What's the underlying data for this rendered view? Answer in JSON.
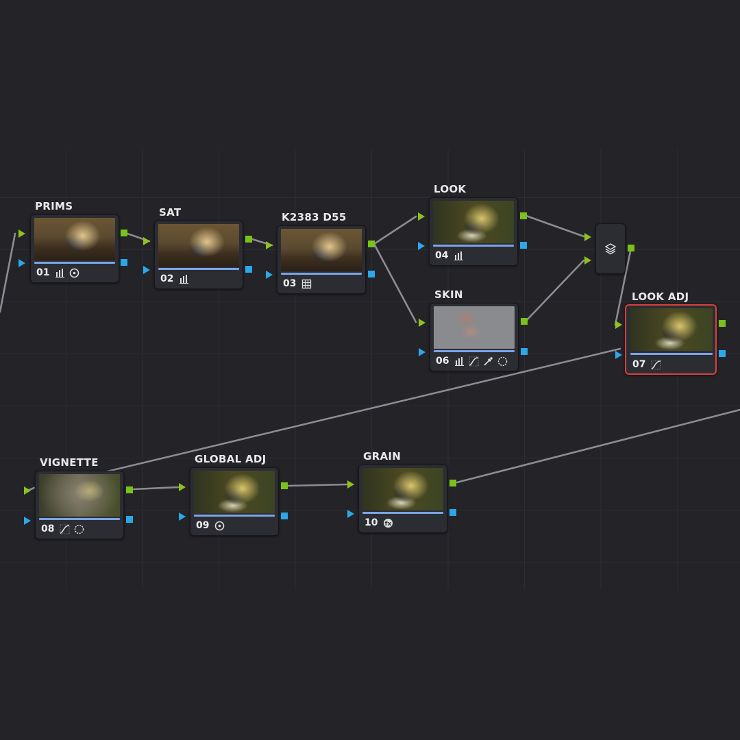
{
  "nodes": [
    {
      "id": "prims",
      "title": "PRIMS",
      "number": "01",
      "tools": [
        "qualifier-bars-icon",
        "window-circle-icon"
      ]
    },
    {
      "id": "sat",
      "title": "SAT",
      "number": "02",
      "tools": [
        "qualifier-bars-icon"
      ]
    },
    {
      "id": "k2383",
      "title": "K2383 D55",
      "number": "03",
      "tools": [
        "lut-grid-icon"
      ]
    },
    {
      "id": "look",
      "title": "LOOK",
      "number": "04",
      "tools": [
        "qualifier-bars-icon"
      ]
    },
    {
      "id": "skin",
      "title": "SKIN",
      "number": "06",
      "tools": [
        "qualifier-bars-icon",
        "curves-icon",
        "eyedropper-icon",
        "window-dashed-circle-icon"
      ]
    },
    {
      "id": "look-adj",
      "title": "LOOK ADJ",
      "number": "07",
      "tools": [
        "curves-icon"
      ],
      "selected": true
    },
    {
      "id": "vignette",
      "title": "VIGNETTE",
      "number": "08",
      "tools": [
        "curves-icon",
        "window-dashed-circle-icon"
      ]
    },
    {
      "id": "global-adj",
      "title": "GLOBAL ADJ",
      "number": "09",
      "tools": [
        "window-circle-icon"
      ]
    },
    {
      "id": "grain",
      "title": "GRAIN",
      "number": "10",
      "tools": [
        "fx-icon"
      ]
    }
  ],
  "layer_mixer": {
    "icon": "layers-icon"
  },
  "colors": {
    "background": "#232328",
    "node": "#2c2d33",
    "rgb_port": "#78c21a",
    "key_port": "#2aa8e8",
    "selected": "#d8413b",
    "wire": "#8a8a90",
    "bar": "#7ba4e8"
  }
}
